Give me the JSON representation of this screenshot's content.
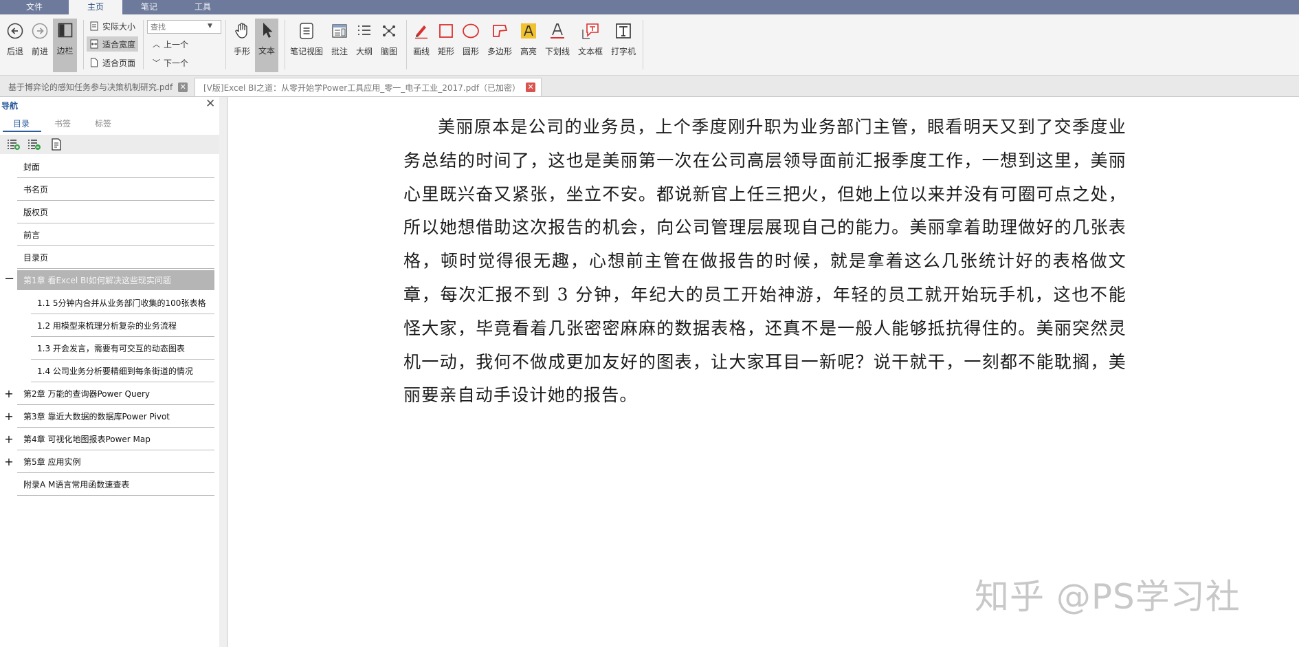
{
  "menubar": {
    "tabs": [
      "文件",
      "主页",
      "笔记",
      "工具"
    ],
    "active": "主页"
  },
  "ribbon": {
    "back": "后退",
    "forward": "前进",
    "sidebar": "边栏",
    "actual_size": "实际大小",
    "fit_width": "适合宽度",
    "fit_page": "适合页面",
    "search_placeholder": "查找",
    "prev": "上一个",
    "next": "下一个",
    "hand": "手形",
    "text": "文本",
    "note_view": "笔记视图",
    "annotate": "批注",
    "outline": "大纲",
    "mindmap": "脑图",
    "line": "画线",
    "rect": "矩形",
    "circle": "圆形",
    "polygon": "多边形",
    "highlight": "高亮",
    "underline": "下划线",
    "textbox": "文本框",
    "typewriter": "打字机"
  },
  "doc_tabs": [
    {
      "title": "基于博弈论的感知任务参与决策机制研究.pdf"
    },
    {
      "title": "[V版]Excel BI之道：从零开始学Power工具应用_零一_电子工业_2017.pdf（已加密）"
    }
  ],
  "nav": {
    "title": "导航",
    "tabs": [
      "目录",
      "书签",
      "标签"
    ],
    "toc": [
      {
        "label": "封面"
      },
      {
        "label": "书名页"
      },
      {
        "label": "版权页"
      },
      {
        "label": "前言"
      },
      {
        "label": "目录页"
      },
      {
        "label": "第1章  看Excel BI如何解决这些现实问题"
      },
      {
        "label": "1.1  5分钟内合并从业务部门收集的100张表格"
      },
      {
        "label": "1.2  用模型来梳理分析复杂的业务流程"
      },
      {
        "label": "1.3  开会发言，需要有可交互的动态图表"
      },
      {
        "label": "1.4  公司业务分析要精细到每条街道的情况"
      },
      {
        "label": "第2章  万能的查询器Power Query"
      },
      {
        "label": "第3章  靠近大数据的数据库Power Pivot"
      },
      {
        "label": "第4章  可视化地图报表Power Map"
      },
      {
        "label": "第5章  应用实例"
      },
      {
        "label": "附录A  M语言常用函数速查表"
      }
    ]
  },
  "page": {
    "paragraph": "美丽原本是公司的业务员，上个季度刚升职为业务部门主管，眼看明天又到了交季度业务总结的时间了，这也是美丽第一次在公司高层领导面前汇报季度工作，一想到这里，美丽心里既兴奋又紧张，坐立不安。都说新官上任三把火，但她上位以来并没有可圈可点之处，所以她想借助这次报告的机会，向公司管理层展现自己的能力。美丽拿着助理做好的几张表格，顿时觉得很无趣，心想前主管在做报告的时候，就是拿着这么几张统计好的表格做文章，每次汇报不到 3 分钟，年纪大的员工开始神游，年轻的员工就开始玩手机，这也不能怪大家，毕竟看着几张密密麻麻的数据表格，还真不是一般人能够抵抗得住的。美丽突然灵机一动，我何不做成更加友好的图表，让大家耳目一新呢？说干就干，一刻都不能耽搁，美丽要亲自动手设计她的报告。",
    "watermark": "知乎 @PS学习社"
  }
}
